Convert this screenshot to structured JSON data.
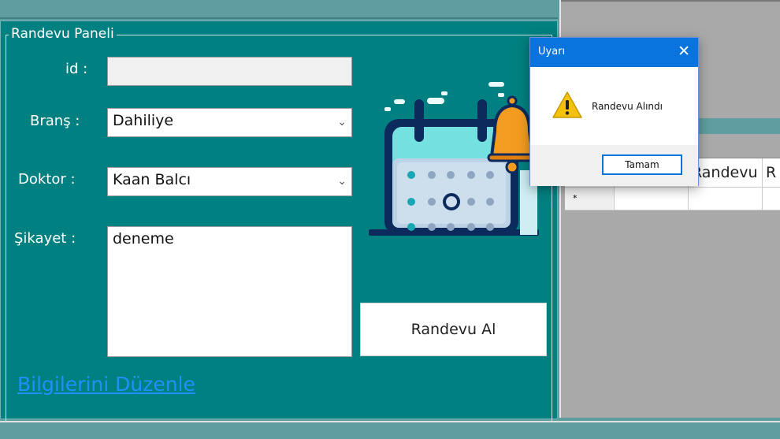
{
  "panel": {
    "title": "Randevu Paneli",
    "fields": {
      "id_label": "id :",
      "id_value": "",
      "brans_label": "Branş :",
      "brans_value": "Dahiliye",
      "doktor_label": "Doktor :",
      "doktor_value": "Kaan Balcı",
      "sikayet_label": "Şikayet :",
      "sikayet_value": "deneme"
    },
    "randevu_button_label": "Randevu Al",
    "edit_link_label": "Bilgilerini Düzenle"
  },
  "grid": {
    "headers": [
      "",
      "",
      "Randevu",
      "R"
    ],
    "new_row_marker": "*"
  },
  "dialog": {
    "title": "Uyarı",
    "message": "Randevu Alındı",
    "ok_label": "Tamam",
    "icon": "warning-icon"
  },
  "colors": {
    "panel_bg": "#008080",
    "window_bg": "#5f9ea0",
    "dialog_title_bg": "#0a74de",
    "link": "#1e90ff"
  }
}
